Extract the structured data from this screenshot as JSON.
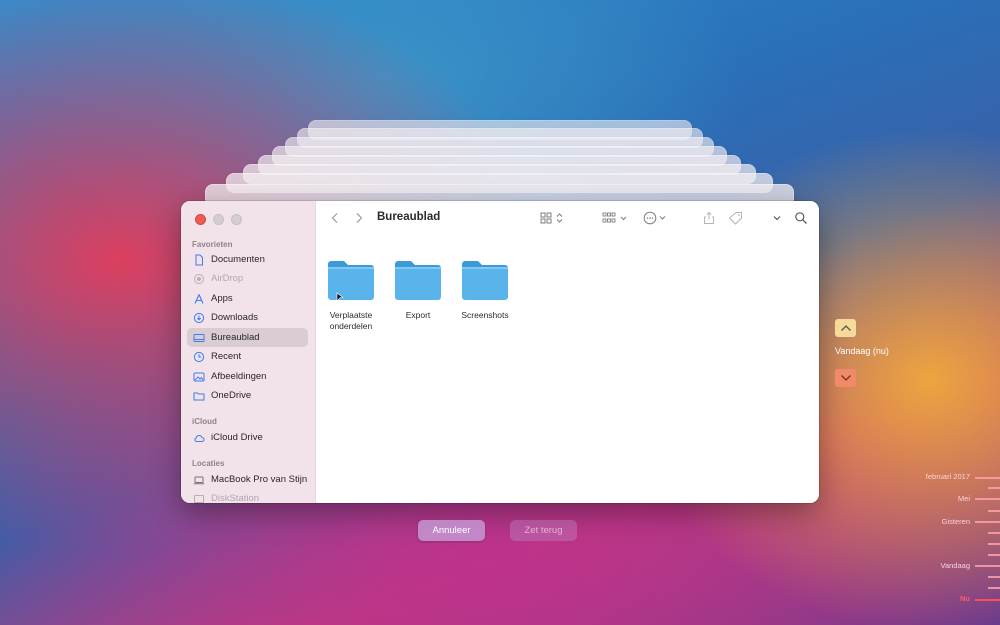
{
  "window": {
    "title": "Bureaublad"
  },
  "sidebar": {
    "sections": [
      {
        "title": "Favorieten"
      },
      {
        "title": "iCloud"
      },
      {
        "title": "Locaties"
      }
    ],
    "favorites": [
      {
        "label": "Documenten",
        "icon": "document-icon"
      },
      {
        "label": "AirDrop",
        "icon": "airdrop-icon"
      },
      {
        "label": "Apps",
        "icon": "apps-icon"
      },
      {
        "label": "Downloads",
        "icon": "downloads-icon"
      },
      {
        "label": "Bureaublad",
        "icon": "desktop-icon",
        "selected": true
      },
      {
        "label": "Recent",
        "icon": "clock-icon"
      },
      {
        "label": "Afbeeldingen",
        "icon": "photos-icon"
      },
      {
        "label": "OneDrive",
        "icon": "folder-icon"
      }
    ],
    "icloud": [
      {
        "label": "iCloud Drive",
        "icon": "cloud-icon"
      }
    ],
    "locations": [
      {
        "label": "MacBook Pro van Stijn",
        "icon": "laptop-icon"
      },
      {
        "label": "DiskStation",
        "icon": "server-icon"
      }
    ]
  },
  "folders": [
    {
      "label_line1": "Verplaatste",
      "label_line2": "onderdelen"
    },
    {
      "label_line1": "Export",
      "label_line2": ""
    },
    {
      "label_line1": "Screenshots",
      "label_line2": ""
    }
  ],
  "buttons": {
    "cancel": "Annuleer",
    "restore": "Zet terug"
  },
  "time_machine": {
    "current": "Vandaag (nu)",
    "timeline": [
      "februari 2017",
      "Mei",
      "Gisteren",
      "Vandaag",
      "Nu"
    ]
  },
  "colors": {
    "folder": "#5ab4ec",
    "accent": "#ee5d54"
  }
}
